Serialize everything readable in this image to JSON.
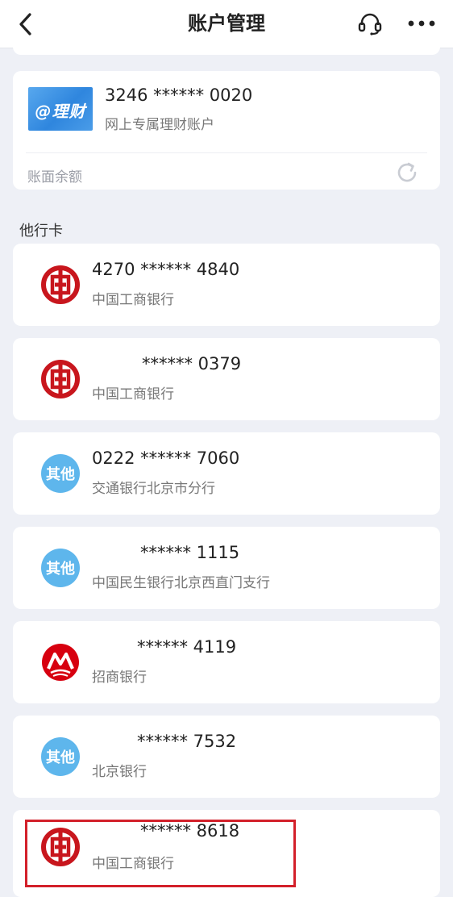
{
  "header": {
    "title": "账户管理"
  },
  "wealth_account": {
    "logo_text": "@理财",
    "number": "3246 ****** 0020",
    "type": "网上专属理财账户",
    "balance_label": "账面余额"
  },
  "other_cards": {
    "section_title": "他行卡",
    "cards": [
      {
        "number": "4270 ****** 4840",
        "bank": "中国工商银行",
        "icon": "icbc-logo-icon"
      },
      {
        "number": "****** 0379",
        "bank": "中国工商银行",
        "icon": "icbc-logo-icon"
      },
      {
        "number": "0222 ****** 7060",
        "bank": "交通银行北京市分行",
        "icon": "other-bank-icon",
        "badge": "其他"
      },
      {
        "number": "****** 1115",
        "bank": "中国民生银行北京西直门支行",
        "icon": "other-bank-icon",
        "badge": "其他"
      },
      {
        "number": "****** 4119",
        "bank": "招商银行",
        "icon": "cmb-logo-icon"
      },
      {
        "number": "****** 7532",
        "bank": "北京银行",
        "icon": "other-bank-icon",
        "badge": "其他"
      },
      {
        "number": "****** 8618",
        "bank": "中国工商银行",
        "icon": "icbc-logo-icon"
      }
    ]
  },
  "colors": {
    "background": "#eef0f6",
    "icbc_red": "#c8161d",
    "cmb_red": "#d7000f",
    "other_badge_blue": "#5eb6ec",
    "highlight_red": "#d3202a"
  }
}
